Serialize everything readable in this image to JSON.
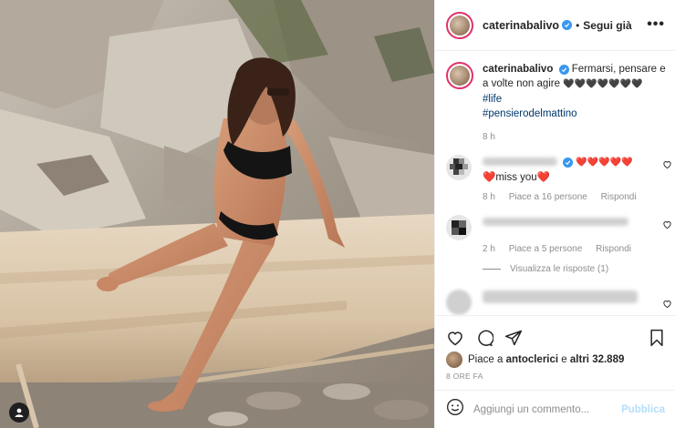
{
  "post": {
    "username": "caterinabalivo",
    "follow_status": "Segui già",
    "separator": "•",
    "more_glyph": "•••"
  },
  "caption": {
    "username": "caterinabalivo",
    "text": "Fermarsi, pensare e a volte non agire",
    "hearts": "🖤🖤🖤🖤🖤🖤🖤",
    "hashtags": [
      "#life",
      "#pensierodelmattino"
    ],
    "time": "8 h"
  },
  "comments": [
    {
      "text_hearts": "❤️❤️❤️❤️❤️",
      "text_line2": "❤️miss you❤️",
      "time": "8 h",
      "likes": "Piace a 16 persone",
      "reply": "Rispondi"
    },
    {
      "time": "2 h",
      "likes": "Piace a 5 persone",
      "reply": "Rispondi"
    }
  ],
  "replies_link": "Visualizza le risposte (1)",
  "likes": {
    "prefix": "Piace a",
    "user": "antoclerici",
    "joiner": "e",
    "others": "altri 32.889"
  },
  "post_date": "8 ORE FA",
  "add_comment": {
    "placeholder": "Aggiungi un commento...",
    "publish": "Pubblica"
  },
  "colors": {
    "verified": "#3897f0",
    "hashtag": "#00376b",
    "publish_disabled": "#b2dffc",
    "story_ring": "#e1306c"
  },
  "icons": [
    "verified-icon",
    "more-icon",
    "heart-icon",
    "comment-icon",
    "share-icon",
    "bookmark-icon",
    "emoji-icon",
    "user-tag-icon"
  ]
}
